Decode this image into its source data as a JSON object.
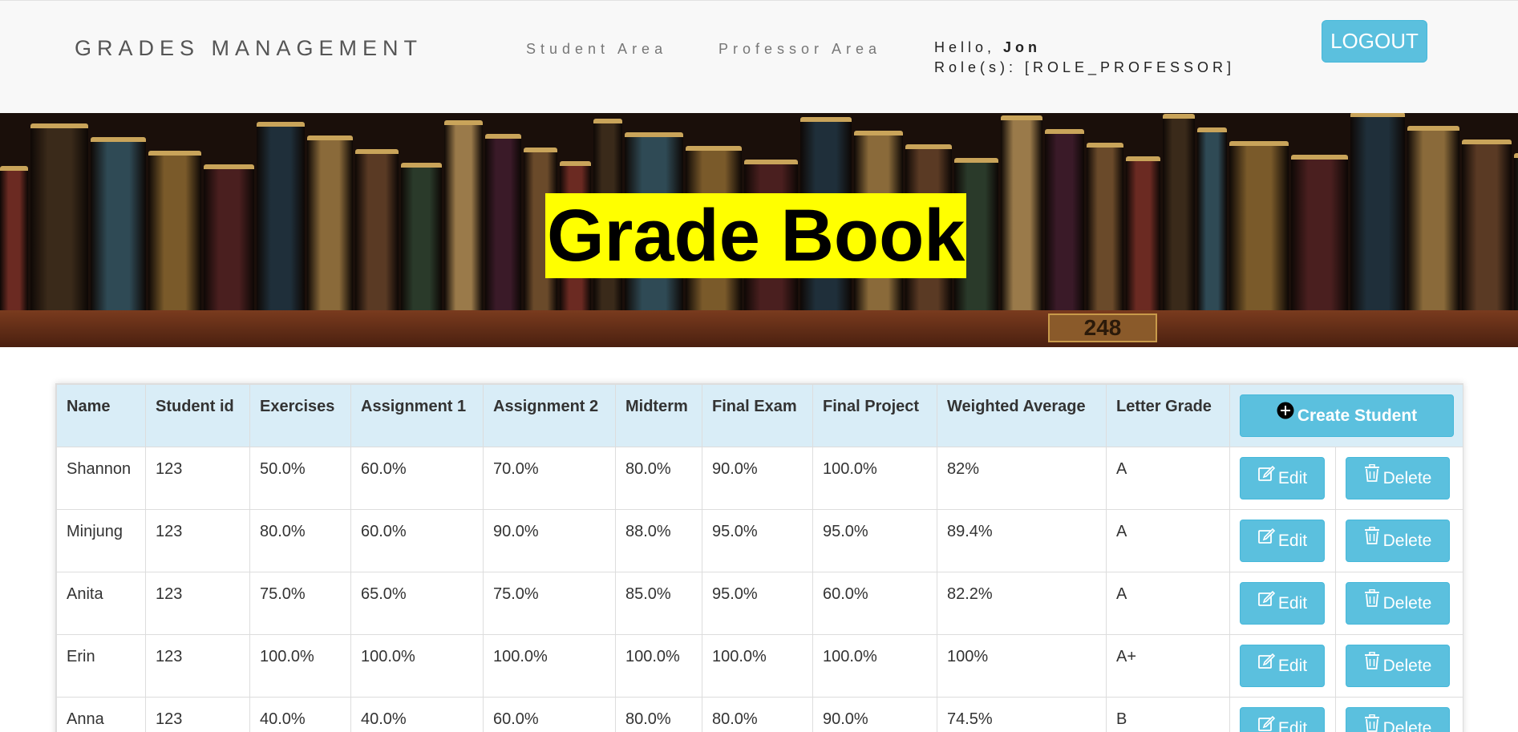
{
  "header": {
    "brand": "GRADES MANAGEMENT",
    "nav": {
      "student_area": "Student Area",
      "professor_area": "Professor Area"
    },
    "user": {
      "hello_prefix": "Hello, ",
      "name": "Jon",
      "roles": "Role(s): [ROLE_PROFESSOR]"
    },
    "logout_label": "LOGOUT"
  },
  "hero": {
    "title": "Grade Book",
    "shelf_number": "248"
  },
  "table": {
    "columns": [
      "Name",
      "Student id",
      "Exercises",
      "Assignment 1",
      "Assignment 2",
      "Midterm",
      "Final Exam",
      "Final Project",
      "Weighted Average",
      "Letter Grade"
    ],
    "create_label": "Create Student",
    "edit_label": "Edit",
    "delete_label": "Delete",
    "rows": [
      [
        "Shannon",
        "123",
        "50.0%",
        "60.0%",
        "70.0%",
        "80.0%",
        "90.0%",
        "100.0%",
        "82%",
        "A"
      ],
      [
        "Minjung",
        "123",
        "80.0%",
        "60.0%",
        "90.0%",
        "88.0%",
        "95.0%",
        "95.0%",
        "89.4%",
        "A"
      ],
      [
        "Anita",
        "123",
        "75.0%",
        "65.0%",
        "75.0%",
        "85.0%",
        "95.0%",
        "60.0%",
        "82.2%",
        "A"
      ],
      [
        "Erin",
        "123",
        "100.0%",
        "100.0%",
        "100.0%",
        "100.0%",
        "100.0%",
        "100.0%",
        "100%",
        "A+"
      ],
      [
        "Anna",
        "123",
        "40.0%",
        "40.0%",
        "60.0%",
        "80.0%",
        "80.0%",
        "90.0%",
        "74.5%",
        "B"
      ]
    ]
  },
  "colors": {
    "accent": "#5bc0de",
    "header_row": "#d9edf7",
    "highlight": "#ffff00"
  }
}
